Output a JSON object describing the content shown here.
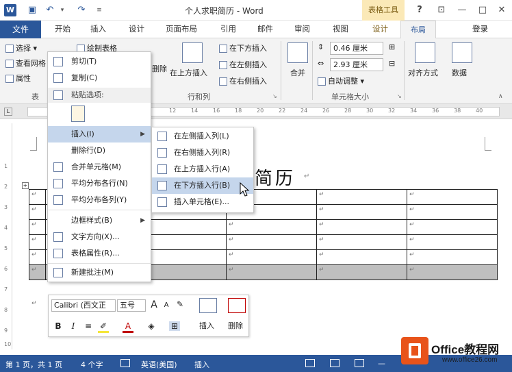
{
  "titlebar": {
    "app_icon": "W",
    "doc_title": "个人求职简历 - Word",
    "context_tab": "表格工具",
    "help": "?",
    "buttons": [
      "ribbon-display-icon",
      "minimize-icon",
      "maximize-icon",
      "close-icon"
    ]
  },
  "tabs": {
    "file": "文件",
    "items": [
      "开始",
      "插入",
      "设计",
      "页面布局",
      "引用",
      "邮件",
      "审阅",
      "视图",
      "设计",
      "布局"
    ],
    "active": "布局",
    "login": "登录"
  },
  "ribbon": {
    "select": "选择",
    "view_gridlines": "查看网格",
    "properties": "属性",
    "group_table": "表",
    "draw_table": "绘制表格",
    "delete": "删除",
    "insert_above": "在上方插入",
    "insert_below": "在下方插入",
    "insert_left": "在左侧插入",
    "insert_right": "在右侧插入",
    "group_rows_cols": "行和列",
    "merge": "合并",
    "height_value": "0.46 厘米",
    "width_value": "2.93 厘米",
    "autofit": "自动调整",
    "group_cell_size": "单元格大小",
    "alignment": "对齐方式",
    "data": "数据"
  },
  "ruler": {
    "ticks": [
      "12",
      "14",
      "16",
      "18",
      "20",
      "22",
      "24",
      "26",
      "28",
      "30",
      "32",
      "34",
      "36",
      "38",
      "40"
    ]
  },
  "vruler": {
    "ticks": [
      "1",
      "2",
      "3",
      "4",
      "5",
      "6",
      "7",
      "8",
      "9",
      "10"
    ]
  },
  "document": {
    "heading": "简历",
    "para_mark": "↵",
    "table_handle": "+"
  },
  "context_menu": {
    "cut": "剪切(T)",
    "copy": "复制(C)",
    "paste_options": "粘贴选项:",
    "insert": "插入(I)",
    "delete_row": "删除行(D)",
    "merge_cells": "合并单元格(M)",
    "distribute_rows": "平均分布各行(N)",
    "distribute_cols": "平均分布各列(Y)",
    "border_styles": "边框样式(B)",
    "text_direction": "文字方向(X)...",
    "table_properties": "表格属性(R)...",
    "new_comment": "新建批注(M)"
  },
  "submenu": {
    "insert_left": "在左侧插入列(L)",
    "insert_right": "在右侧插入列(R)",
    "insert_above": "在上方插入行(A)",
    "insert_below": "在下方插入行(B)",
    "insert_cells": "插入单元格(E)..."
  },
  "mini_toolbar": {
    "font": "Calibri (西文正",
    "size": "五号",
    "grow": "A",
    "shrink": "A",
    "bold": "B",
    "italic": "I",
    "insert": "插入",
    "delete": "删除"
  },
  "statusbar": {
    "page": "第 1 页，共 1 页",
    "words": "4 个字",
    "language": "英语(美国)",
    "mode": "插入"
  },
  "watermark": {
    "brand": "Office教程网",
    "url": "www.office26.com"
  },
  "colors": {
    "accent": "#2b579a",
    "context_tab_bg": "#fbe9b7",
    "highlight": "#c5d6ec",
    "selected_row": "#bfbfbf"
  }
}
